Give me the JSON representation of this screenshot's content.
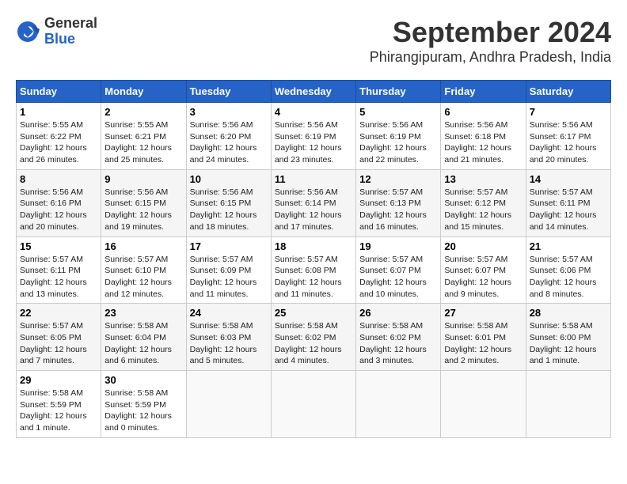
{
  "header": {
    "logo_general": "General",
    "logo_blue": "Blue",
    "month_title": "September 2024",
    "location": "Phirangipuram, Andhra Pradesh, India"
  },
  "weekdays": [
    "Sunday",
    "Monday",
    "Tuesday",
    "Wednesday",
    "Thursday",
    "Friday",
    "Saturday"
  ],
  "weeks": [
    [
      {
        "day": "1",
        "sunrise": "5:55 AM",
        "sunset": "6:22 PM",
        "daylight": "12 hours and 26 minutes."
      },
      {
        "day": "2",
        "sunrise": "5:55 AM",
        "sunset": "6:21 PM",
        "daylight": "12 hours and 25 minutes."
      },
      {
        "day": "3",
        "sunrise": "5:56 AM",
        "sunset": "6:20 PM",
        "daylight": "12 hours and 24 minutes."
      },
      {
        "day": "4",
        "sunrise": "5:56 AM",
        "sunset": "6:19 PM",
        "daylight": "12 hours and 23 minutes."
      },
      {
        "day": "5",
        "sunrise": "5:56 AM",
        "sunset": "6:19 PM",
        "daylight": "12 hours and 22 minutes."
      },
      {
        "day": "6",
        "sunrise": "5:56 AM",
        "sunset": "6:18 PM",
        "daylight": "12 hours and 21 minutes."
      },
      {
        "day": "7",
        "sunrise": "5:56 AM",
        "sunset": "6:17 PM",
        "daylight": "12 hours and 20 minutes."
      }
    ],
    [
      {
        "day": "8",
        "sunrise": "5:56 AM",
        "sunset": "6:16 PM",
        "daylight": "12 hours and 20 minutes."
      },
      {
        "day": "9",
        "sunrise": "5:56 AM",
        "sunset": "6:15 PM",
        "daylight": "12 hours and 19 minutes."
      },
      {
        "day": "10",
        "sunrise": "5:56 AM",
        "sunset": "6:15 PM",
        "daylight": "12 hours and 18 minutes."
      },
      {
        "day": "11",
        "sunrise": "5:56 AM",
        "sunset": "6:14 PM",
        "daylight": "12 hours and 17 minutes."
      },
      {
        "day": "12",
        "sunrise": "5:57 AM",
        "sunset": "6:13 PM",
        "daylight": "12 hours and 16 minutes."
      },
      {
        "day": "13",
        "sunrise": "5:57 AM",
        "sunset": "6:12 PM",
        "daylight": "12 hours and 15 minutes."
      },
      {
        "day": "14",
        "sunrise": "5:57 AM",
        "sunset": "6:11 PM",
        "daylight": "12 hours and 14 minutes."
      }
    ],
    [
      {
        "day": "15",
        "sunrise": "5:57 AM",
        "sunset": "6:11 PM",
        "daylight": "12 hours and 13 minutes."
      },
      {
        "day": "16",
        "sunrise": "5:57 AM",
        "sunset": "6:10 PM",
        "daylight": "12 hours and 12 minutes."
      },
      {
        "day": "17",
        "sunrise": "5:57 AM",
        "sunset": "6:09 PM",
        "daylight": "12 hours and 11 minutes."
      },
      {
        "day": "18",
        "sunrise": "5:57 AM",
        "sunset": "6:08 PM",
        "daylight": "12 hours and 11 minutes."
      },
      {
        "day": "19",
        "sunrise": "5:57 AM",
        "sunset": "6:07 PM",
        "daylight": "12 hours and 10 minutes."
      },
      {
        "day": "20",
        "sunrise": "5:57 AM",
        "sunset": "6:07 PM",
        "daylight": "12 hours and 9 minutes."
      },
      {
        "day": "21",
        "sunrise": "5:57 AM",
        "sunset": "6:06 PM",
        "daylight": "12 hours and 8 minutes."
      }
    ],
    [
      {
        "day": "22",
        "sunrise": "5:57 AM",
        "sunset": "6:05 PM",
        "daylight": "12 hours and 7 minutes."
      },
      {
        "day": "23",
        "sunrise": "5:58 AM",
        "sunset": "6:04 PM",
        "daylight": "12 hours and 6 minutes."
      },
      {
        "day": "24",
        "sunrise": "5:58 AM",
        "sunset": "6:03 PM",
        "daylight": "12 hours and 5 minutes."
      },
      {
        "day": "25",
        "sunrise": "5:58 AM",
        "sunset": "6:02 PM",
        "daylight": "12 hours and 4 minutes."
      },
      {
        "day": "26",
        "sunrise": "5:58 AM",
        "sunset": "6:02 PM",
        "daylight": "12 hours and 3 minutes."
      },
      {
        "day": "27",
        "sunrise": "5:58 AM",
        "sunset": "6:01 PM",
        "daylight": "12 hours and 2 minutes."
      },
      {
        "day": "28",
        "sunrise": "5:58 AM",
        "sunset": "6:00 PM",
        "daylight": "12 hours and 1 minute."
      }
    ],
    [
      {
        "day": "29",
        "sunrise": "5:58 AM",
        "sunset": "5:59 PM",
        "daylight": "12 hours and 1 minute."
      },
      {
        "day": "30",
        "sunrise": "5:58 AM",
        "sunset": "5:59 PM",
        "daylight": "12 hours and 0 minutes."
      },
      null,
      null,
      null,
      null,
      null
    ]
  ],
  "labels": {
    "sunrise": "Sunrise:",
    "sunset": "Sunset:",
    "daylight": "Daylight:"
  }
}
